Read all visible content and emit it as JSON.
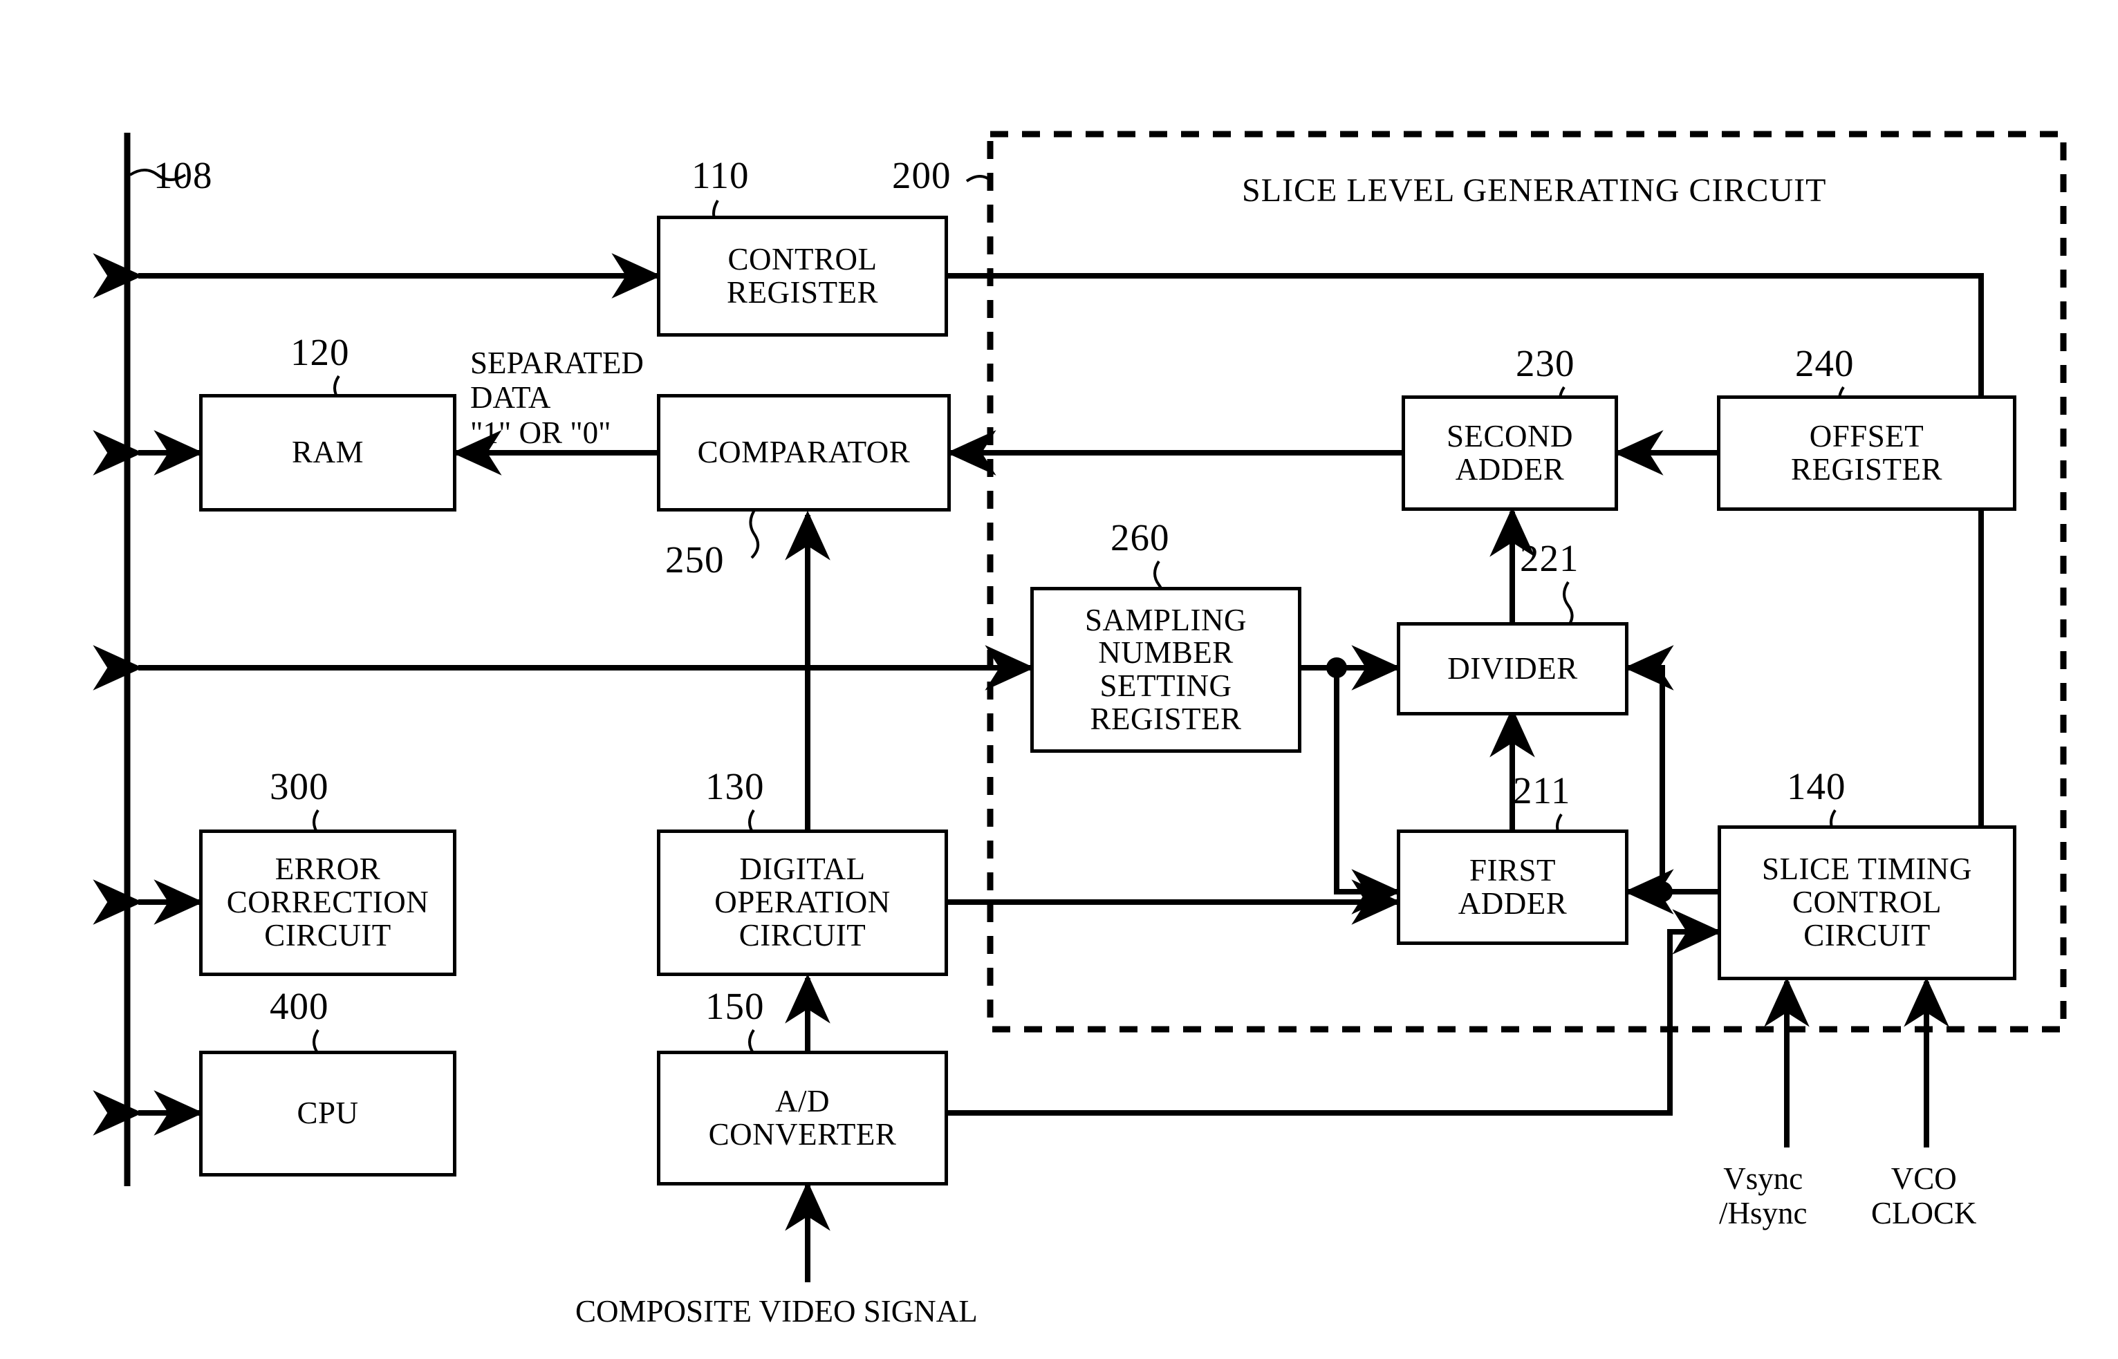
{
  "figure": {
    "type": "patent-block-diagram",
    "bus_label": "108",
    "section": {
      "title": "SLICE LEVEL GENERATING CIRCUIT",
      "ref": "200"
    }
  },
  "blocks": [
    {
      "id": "control-register",
      "ref": "110",
      "label": "CONTROL\nREGISTER"
    },
    {
      "id": "ram",
      "ref": "120",
      "label": "RAM"
    },
    {
      "id": "comparator",
      "ref": "250",
      "label": "COMPARATOR"
    },
    {
      "id": "second-adder",
      "ref": "230",
      "label": "SECOND\nADDER"
    },
    {
      "id": "offset-register",
      "ref": "240",
      "label": "OFFSET\nREGISTER"
    },
    {
      "id": "sampling-number-setting-register",
      "ref": "260",
      "label": "SAMPLING\nNUMBER\nSETTING\nREGISTER"
    },
    {
      "id": "divider",
      "ref": "221",
      "label": "DIVIDER"
    },
    {
      "id": "error-correction-circuit",
      "ref": "300",
      "label": "ERROR\nCORRECTION\nCIRCUIT"
    },
    {
      "id": "digital-operation-circuit",
      "ref": "130",
      "label": "DIGITAL\nOPERATION\nCIRCUIT"
    },
    {
      "id": "first-adder",
      "ref": "211",
      "label": "FIRST\nADDER"
    },
    {
      "id": "slice-timing-control-circuit",
      "ref": "140",
      "label": "SLICE TIMING\nCONTROL\nCIRCUIT"
    },
    {
      "id": "cpu",
      "ref": "400",
      "label": "CPU"
    },
    {
      "id": "ad-converter",
      "ref": "150",
      "label": "A/D\nCONVERTER"
    }
  ],
  "annotations": {
    "separated_data": "SEPARATED\nDATA\n\"1\" OR \"0\"",
    "composite_video_signal": "COMPOSITE VIDEO SIGNAL",
    "vsync_hsync": "Vsync\n/Hsync",
    "vco_clock": "VCO\nCLOCK"
  },
  "colors": {
    "ink": "#000000",
    "background": "#ffffff"
  }
}
